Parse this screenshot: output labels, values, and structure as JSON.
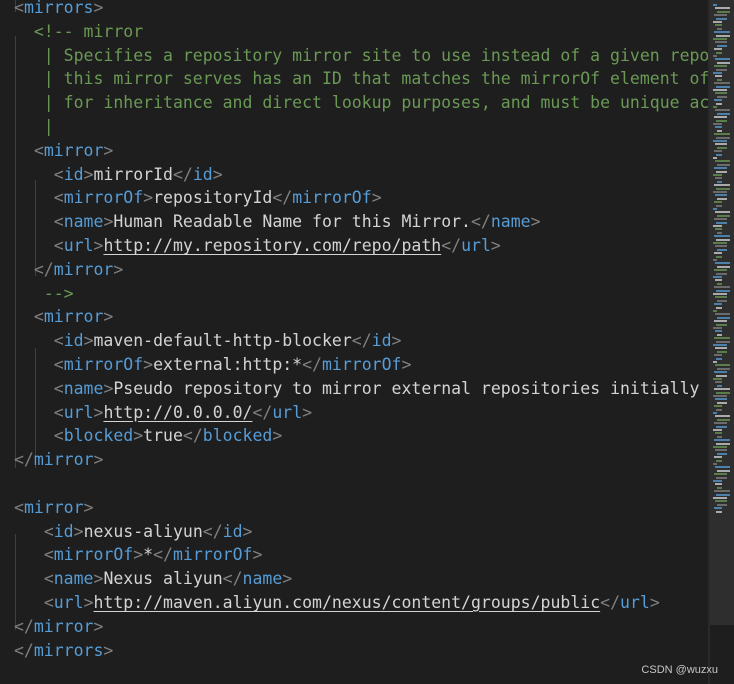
{
  "editor": {
    "language": "xml",
    "colors": {
      "background": "#1e1e1e",
      "tag": "#569cd6",
      "bracket": "#808080",
      "text": "#d4d4d4",
      "comment": "#6a9955"
    }
  },
  "lines": [
    [
      {
        "t": "<",
        "c": "br"
      },
      {
        "t": "mirrors",
        "c": "tag"
      },
      {
        "t": ">",
        "c": "br"
      }
    ],
    [
      {
        "t": "  "
      },
      {
        "t": "<!-- mirror",
        "c": "cm"
      }
    ],
    [
      {
        "t": "   | Specifies a repository mirror site to use instead of a given reposi",
        "c": "cm"
      }
    ],
    [
      {
        "t": "   | this mirror serves has an ID that matches the mirrorOf element of t",
        "c": "cm"
      }
    ],
    [
      {
        "t": "   | for inheritance and direct lookup purposes, and must be unique acro",
        "c": "cm"
      }
    ],
    [
      {
        "t": "   |",
        "c": "cm"
      }
    ],
    [
      {
        "t": "  "
      },
      {
        "t": "<",
        "c": "br"
      },
      {
        "t": "mirror",
        "c": "tag"
      },
      {
        "t": ">",
        "c": "br"
      }
    ],
    [
      {
        "t": "    "
      },
      {
        "t": "<",
        "c": "br"
      },
      {
        "t": "id",
        "c": "tag"
      },
      {
        "t": ">",
        "c": "br"
      },
      {
        "t": "mirrorId",
        "c": "txt"
      },
      {
        "t": "</",
        "c": "br"
      },
      {
        "t": "id",
        "c": "tag"
      },
      {
        "t": ">",
        "c": "br"
      }
    ],
    [
      {
        "t": "    "
      },
      {
        "t": "<",
        "c": "br"
      },
      {
        "t": "mirrorOf",
        "c": "tag"
      },
      {
        "t": ">",
        "c": "br"
      },
      {
        "t": "repositoryId",
        "c": "txt"
      },
      {
        "t": "</",
        "c": "br"
      },
      {
        "t": "mirrorOf",
        "c": "tag"
      },
      {
        "t": ">",
        "c": "br"
      }
    ],
    [
      {
        "t": "    "
      },
      {
        "t": "<",
        "c": "br"
      },
      {
        "t": "name",
        "c": "tag"
      },
      {
        "t": ">",
        "c": "br"
      },
      {
        "t": "Human Readable Name for this Mirror.",
        "c": "txt"
      },
      {
        "t": "</",
        "c": "br"
      },
      {
        "t": "name",
        "c": "tag"
      },
      {
        "t": ">",
        "c": "br"
      }
    ],
    [
      {
        "t": "    "
      },
      {
        "t": "<",
        "c": "br"
      },
      {
        "t": "url",
        "c": "tag"
      },
      {
        "t": ">",
        "c": "br"
      },
      {
        "t": "http://my.repository.com/repo/path",
        "c": "txt url"
      },
      {
        "t": "</",
        "c": "br"
      },
      {
        "t": "url",
        "c": "tag"
      },
      {
        "t": ">",
        "c": "br"
      }
    ],
    [
      {
        "t": "  "
      },
      {
        "t": "</",
        "c": "br"
      },
      {
        "t": "mirror",
        "c": "tag"
      },
      {
        "t": ">",
        "c": "br"
      }
    ],
    [
      {
        "t": "   "
      },
      {
        "t": "-->",
        "c": "cm"
      }
    ],
    [
      {
        "t": "  "
      },
      {
        "t": "<",
        "c": "br"
      },
      {
        "t": "mirror",
        "c": "tag"
      },
      {
        "t": ">",
        "c": "br"
      }
    ],
    [
      {
        "t": "    "
      },
      {
        "t": "<",
        "c": "br"
      },
      {
        "t": "id",
        "c": "tag"
      },
      {
        "t": ">",
        "c": "br"
      },
      {
        "t": "maven-default-http-blocker",
        "c": "txt"
      },
      {
        "t": "</",
        "c": "br"
      },
      {
        "t": "id",
        "c": "tag"
      },
      {
        "t": ">",
        "c": "br"
      }
    ],
    [
      {
        "t": "    "
      },
      {
        "t": "<",
        "c": "br"
      },
      {
        "t": "mirrorOf",
        "c": "tag"
      },
      {
        "t": ">",
        "c": "br"
      },
      {
        "t": "external:http:*",
        "c": "txt"
      },
      {
        "t": "</",
        "c": "br"
      },
      {
        "t": "mirrorOf",
        "c": "tag"
      },
      {
        "t": ">",
        "c": "br"
      }
    ],
    [
      {
        "t": "    "
      },
      {
        "t": "<",
        "c": "br"
      },
      {
        "t": "name",
        "c": "tag"
      },
      {
        "t": ">",
        "c": "br"
      },
      {
        "t": "Pseudo repository to mirror external repositories initially us",
        "c": "txt"
      }
    ],
    [
      {
        "t": "    "
      },
      {
        "t": "<",
        "c": "br"
      },
      {
        "t": "url",
        "c": "tag"
      },
      {
        "t": ">",
        "c": "br"
      },
      {
        "t": "http://0.0.0.0/",
        "c": "txt url"
      },
      {
        "t": "</",
        "c": "br"
      },
      {
        "t": "url",
        "c": "tag"
      },
      {
        "t": ">",
        "c": "br"
      }
    ],
    [
      {
        "t": "    "
      },
      {
        "t": "<",
        "c": "br"
      },
      {
        "t": "blocked",
        "c": "tag"
      },
      {
        "t": ">",
        "c": "br"
      },
      {
        "t": "true",
        "c": "txt"
      },
      {
        "t": "</",
        "c": "br"
      },
      {
        "t": "blocked",
        "c": "tag"
      },
      {
        "t": ">",
        "c": "br"
      }
    ],
    [
      {
        "t": "</",
        "c": "br"
      },
      {
        "t": "mirror",
        "c": "tag"
      },
      {
        "t": ">",
        "c": "br"
      }
    ],
    [],
    [
      {
        "t": "<",
        "c": "br"
      },
      {
        "t": "mirror",
        "c": "tag"
      },
      {
        "t": ">",
        "c": "br"
      }
    ],
    [
      {
        "t": "   "
      },
      {
        "t": "<",
        "c": "br"
      },
      {
        "t": "id",
        "c": "tag"
      },
      {
        "t": ">",
        "c": "br"
      },
      {
        "t": "nexus-aliyun",
        "c": "txt"
      },
      {
        "t": "</",
        "c": "br"
      },
      {
        "t": "id",
        "c": "tag"
      },
      {
        "t": ">",
        "c": "br"
      }
    ],
    [
      {
        "t": "   "
      },
      {
        "t": "<",
        "c": "br"
      },
      {
        "t": "mirrorOf",
        "c": "tag"
      },
      {
        "t": ">",
        "c": "br"
      },
      {
        "t": "*",
        "c": "txt"
      },
      {
        "t": "</",
        "c": "br"
      },
      {
        "t": "mirrorOf",
        "c": "tag"
      },
      {
        "t": ">",
        "c": "br"
      }
    ],
    [
      {
        "t": "   "
      },
      {
        "t": "<",
        "c": "br"
      },
      {
        "t": "name",
        "c": "tag"
      },
      {
        "t": ">",
        "c": "br"
      },
      {
        "t": "Nexus aliyun",
        "c": "txt"
      },
      {
        "t": "</",
        "c": "br"
      },
      {
        "t": "name",
        "c": "tag"
      },
      {
        "t": ">",
        "c": "br"
      }
    ],
    [
      {
        "t": "   "
      },
      {
        "t": "<",
        "c": "br"
      },
      {
        "t": "url",
        "c": "tag"
      },
      {
        "t": ">",
        "c": "br"
      },
      {
        "t": "http://maven.aliyun.com/nexus/content/groups/public",
        "c": "txt url"
      },
      {
        "t": "</",
        "c": "br"
      },
      {
        "t": "url",
        "c": "tag"
      },
      {
        "t": ">",
        "c": "br"
      }
    ],
    [
      {
        "t": "</",
        "c": "br"
      },
      {
        "t": "mirror",
        "c": "tag"
      },
      {
        "t": ">",
        "c": "br"
      }
    ],
    [
      {
        "t": "</",
        "c": "br"
      },
      {
        "t": "mirrors",
        "c": "tag"
      },
      {
        "t": ">",
        "c": "br"
      }
    ]
  ],
  "watermark": "CSDN @wuzxu"
}
